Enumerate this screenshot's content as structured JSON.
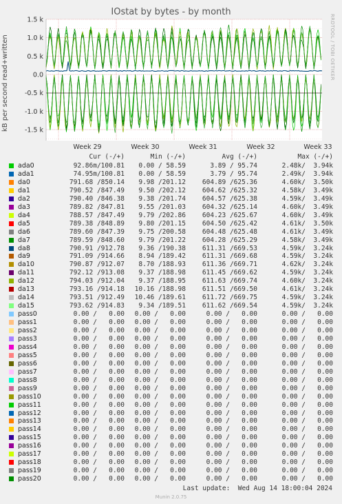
{
  "title": "IOstat by bytes - by month",
  "side_credit": "RRDTOOL / TOBI OETIKER",
  "headers": [
    "Cur (-/+)",
    "Min (-/+)",
    "Avg (-/+)",
    "Max (-/+)"
  ],
  "legend": [
    {
      "name": "ada0",
      "color": "#00cc00",
      "cur": "92.86m/100.81",
      "min": "0.00 / 58.59",
      "avg": "3.89 / 95.74",
      "max": "2.48k/  3.94k"
    },
    {
      "name": "ada1",
      "color": "#0066b3",
      "cur": "74.95m/100.81",
      "min": "0.00 / 58.59",
      "avg": "3.79 / 95.74",
      "max": "2.49k/  3.94k"
    },
    {
      "name": "da0",
      "color": "#ff8000",
      "cur": "791.68 /850.14",
      "min": "9.98 /201.12",
      "avg": "604.89 /625.36",
      "max": "4.60k/  3.50k"
    },
    {
      "name": "da1",
      "color": "#ffcc00",
      "cur": "790.52 /847.49",
      "min": "9.50 /202.12",
      "avg": "604.62 /625.32",
      "max": "4.58k/  3.49k"
    },
    {
      "name": "da2",
      "color": "#330099",
      "cur": "790.40 /846.38",
      "min": "9.38 /201.74",
      "avg": "604.57 /625.38",
      "max": "4.59k/  3.49k"
    },
    {
      "name": "da3",
      "color": "#990099",
      "cur": "789.82 /847.81",
      "min": "9.55 /201.03",
      "avg": "604.32 /625.14",
      "max": "4.60k/  3.49k"
    },
    {
      "name": "da4",
      "color": "#ccff00",
      "cur": "788.57 /847.49",
      "min": "9.79 /202.86",
      "avg": "604.23 /625.67",
      "max": "4.60k/  3.49k"
    },
    {
      "name": "da5",
      "color": "#ff0000",
      "cur": "789.38 /848.89",
      "min": "9.80 /201.15",
      "avg": "604.50 /625.42",
      "max": "4.61k/  3.50k"
    },
    {
      "name": "da6",
      "color": "#808080",
      "cur": "789.60 /847.39",
      "min": "9.75 /200.58",
      "avg": "604.48 /625.48",
      "max": "4.61k/  3.49k"
    },
    {
      "name": "da7",
      "color": "#008f00",
      "cur": "789.59 /848.60",
      "min": "9.79 /201.22",
      "avg": "604.28 /625.29",
      "max": "4.58k/  3.49k"
    },
    {
      "name": "da8",
      "color": "#00487d",
      "cur": "790.91 /912.78",
      "min": "9.36 /190.38",
      "avg": "611.31 /669.53",
      "max": "4.59k/  3.24k"
    },
    {
      "name": "da9",
      "color": "#b35a00",
      "cur": "791.09 /914.66",
      "min": "8.94 /189.42",
      "avg": "611.31 /669.68",
      "max": "4.59k/  3.24k"
    },
    {
      "name": "da10",
      "color": "#b38f00",
      "cur": "790.87 /912.07",
      "min": "8.70 /188.93",
      "avg": "611.36 /669.71",
      "max": "4.62k/  3.24k"
    },
    {
      "name": "da11",
      "color": "#6b006b",
      "cur": "792.12 /913.08",
      "min": "9.37 /188.98",
      "avg": "611.45 /669.62",
      "max": "4.59k/  3.24k"
    },
    {
      "name": "da12",
      "color": "#8fb300",
      "cur": "794.03 /912.04",
      "min": "9.37 /188.95",
      "avg": "611.63 /669.74",
      "max": "4.60k/  3.24k"
    },
    {
      "name": "da13",
      "color": "#b30000",
      "cur": "793.16 /914.18",
      "min": "10.16 /188.98",
      "avg": "611.51 /669.50",
      "max": "4.61k/  3.24k"
    },
    {
      "name": "da14",
      "color": "#bebebe",
      "cur": "793.51 /912.49",
      "min": "10.46 /189.61",
      "avg": "611.72 /669.75",
      "max": "4.59k/  3.24k"
    },
    {
      "name": "da15",
      "color": "#80ff80",
      "cur": "793.62 /914.83",
      "min": "9.34 /189.51",
      "avg": "611.62 /669.54",
      "max": "4.59k/  3.24k"
    },
    {
      "name": "pass0",
      "color": "#80c9ff",
      "cur": "0.00 /   0.00",
      "min": "0.00 /   0.00",
      "avg": "0.00 /   0.00",
      "max": "0.00 /   0.00"
    },
    {
      "name": "pass1",
      "color": "#ffc080",
      "cur": "0.00 /   0.00",
      "min": "0.00 /   0.00",
      "avg": "0.00 /   0.00",
      "max": "0.00 /   0.00"
    },
    {
      "name": "pass2",
      "color": "#ffe680",
      "cur": "0.00 /   0.00",
      "min": "0.00 /   0.00",
      "avg": "0.00 /   0.00",
      "max": "0.00 /   0.00"
    },
    {
      "name": "pass3",
      "color": "#aa80ff",
      "cur": "0.00 /   0.00",
      "min": "0.00 /   0.00",
      "avg": "0.00 /   0.00",
      "max": "0.00 /   0.00"
    },
    {
      "name": "pass4",
      "color": "#ee00cc",
      "cur": "0.00 /   0.00",
      "min": "0.00 /   0.00",
      "avg": "0.00 /   0.00",
      "max": "0.00 /   0.00"
    },
    {
      "name": "pass5",
      "color": "#ff8080",
      "cur": "0.00 /   0.00",
      "min": "0.00 /   0.00",
      "avg": "0.00 /   0.00",
      "max": "0.00 /   0.00"
    },
    {
      "name": "pass6",
      "color": "#666600",
      "cur": "0.00 /   0.00",
      "min": "0.00 /   0.00",
      "avg": "0.00 /   0.00",
      "max": "0.00 /   0.00"
    },
    {
      "name": "pass7",
      "color": "#ffbfff",
      "cur": "0.00 /   0.00",
      "min": "0.00 /   0.00",
      "avg": "0.00 /   0.00",
      "max": "0.00 /   0.00"
    },
    {
      "name": "pass8",
      "color": "#00ffcc",
      "cur": "0.00 /   0.00",
      "min": "0.00 /   0.00",
      "avg": "0.00 /   0.00",
      "max": "0.00 /   0.00"
    },
    {
      "name": "pass9",
      "color": "#cc6699",
      "cur": "0.00 /   0.00",
      "min": "0.00 /   0.00",
      "avg": "0.00 /   0.00",
      "max": "0.00 /   0.00"
    },
    {
      "name": "pass10",
      "color": "#999900",
      "cur": "0.00 /   0.00",
      "min": "0.00 /   0.00",
      "avg": "0.00 /   0.00",
      "max": "0.00 /   0.00"
    },
    {
      "name": "pass11",
      "color": "#00cc00",
      "cur": "0.00 /   0.00",
      "min": "0.00 /   0.00",
      "avg": "0.00 /   0.00",
      "max": "0.00 /   0.00"
    },
    {
      "name": "pass12",
      "color": "#0066b3",
      "cur": "0.00 /   0.00",
      "min": "0.00 /   0.00",
      "avg": "0.00 /   0.00",
      "max": "0.00 /   0.00"
    },
    {
      "name": "pass13",
      "color": "#ff8000",
      "cur": "0.00 /   0.00",
      "min": "0.00 /   0.00",
      "avg": "0.00 /   0.00",
      "max": "0.00 /   0.00"
    },
    {
      "name": "pass14",
      "color": "#ffcc00",
      "cur": "0.00 /   0.00",
      "min": "0.00 /   0.00",
      "avg": "0.00 /   0.00",
      "max": "0.00 /   0.00"
    },
    {
      "name": "pass15",
      "color": "#330099",
      "cur": "0.00 /   0.00",
      "min": "0.00 /   0.00",
      "avg": "0.00 /   0.00",
      "max": "0.00 /   0.00"
    },
    {
      "name": "pass16",
      "color": "#990099",
      "cur": "0.00 /   0.00",
      "min": "0.00 /   0.00",
      "avg": "0.00 /   0.00",
      "max": "0.00 /   0.00"
    },
    {
      "name": "pass17",
      "color": "#ccff00",
      "cur": "0.00 /   0.00",
      "min": "0.00 /   0.00",
      "avg": "0.00 /   0.00",
      "max": "0.00 /   0.00"
    },
    {
      "name": "pass18",
      "color": "#ff0000",
      "cur": "0.00 /   0.00",
      "min": "0.00 /   0.00",
      "avg": "0.00 /   0.00",
      "max": "0.00 /   0.00"
    },
    {
      "name": "pass19",
      "color": "#808080",
      "cur": "0.00 /   0.00",
      "min": "0.00 /   0.00",
      "avg": "0.00 /   0.00",
      "max": "0.00 /   0.00"
    },
    {
      "name": "pass20",
      "color": "#008f00",
      "cur": "0.00 /   0.00",
      "min": "0.00 /   0.00",
      "avg": "0.00 /   0.00",
      "max": "0.00 /   0.00"
    }
  ],
  "footer": "Last update:  Wed Aug 14 18:00:04 2024",
  "munin_version": "Munin 2.0.75",
  "chart_data": {
    "type": "line",
    "title": "IOstat by bytes - by month",
    "ylabel": "kB per second read+written",
    "xlabel": "",
    "ylim": [
      -1800,
      1500
    ],
    "yticks": [
      1500,
      1000,
      500,
      0,
      -500,
      -1000,
      -1500
    ],
    "ytick_labels": [
      "1.5 k",
      "1.0 k",
      "0.5 k",
      "0.0",
      "-0.5 k",
      "-1.0 k",
      "-1.5 k"
    ],
    "x_categories": [
      "Week 29",
      "Week 30",
      "Week 31",
      "Week 32",
      "Week 33"
    ],
    "grid": true,
    "series_note": "written shown above zero, read below zero (mirrored); da* disks oscillate daily ~200-1350 kB/s written and ~-100 to -1600 kB/s read; ada* ~100 kB/s",
    "series": [
      {
        "name": "da0..da15 written",
        "color": "#008f00",
        "daily_peak": 1300,
        "daily_min": 200,
        "avg": 625
      },
      {
        "name": "da0..da15 read",
        "color": "#008f00",
        "daily_peak": -1550,
        "daily_min": -50,
        "avg": -605
      },
      {
        "name": "ada0/ada1 written",
        "color": "#00487d",
        "avg": 96,
        "max": 3940
      }
    ]
  }
}
